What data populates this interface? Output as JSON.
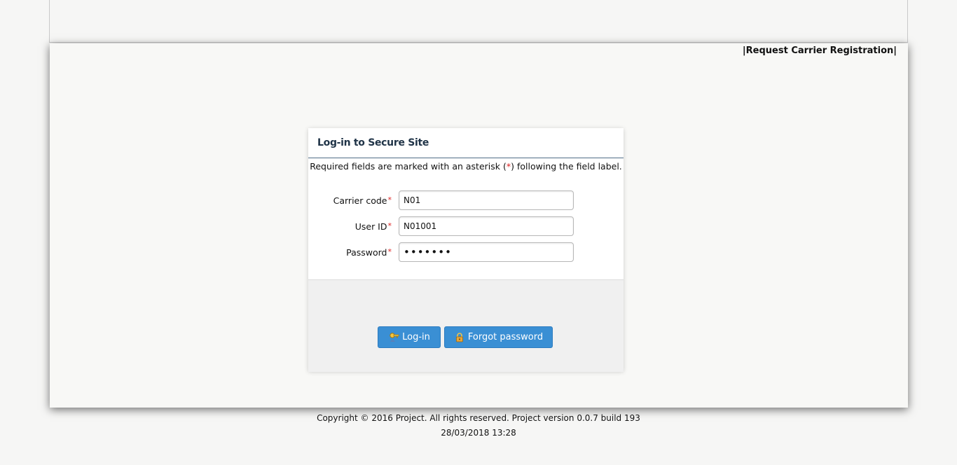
{
  "header": {
    "register_link": "Request Carrier Registration",
    "separator": "|"
  },
  "login": {
    "title": "Log-in to Secure Site",
    "note_prefix": "Required fields are marked with an asterisk (",
    "note_asterisk": "*",
    "note_suffix": ") following the field label.",
    "fields": [
      {
        "label": "Carrier code",
        "value": "N01"
      },
      {
        "label": "User ID",
        "value": "N01001"
      },
      {
        "label": "Password",
        "value": "•••••••"
      }
    ],
    "required_mark": "*",
    "login_button": "Log-in",
    "forgot_button": "Forgot password"
  },
  "footer": {
    "copyright": "Copyright © 2016 Project. All rights reserved. Project version 0.0.7 build 193",
    "datetime": "28/03/2018 13:28"
  },
  "colors": {
    "button_bg": "#3a8fd4",
    "required_asterisk": "#dd2222",
    "header_rule": "#4f6d86"
  },
  "icons": {
    "login": "key-person-icon",
    "forgot": "lock-icon"
  }
}
